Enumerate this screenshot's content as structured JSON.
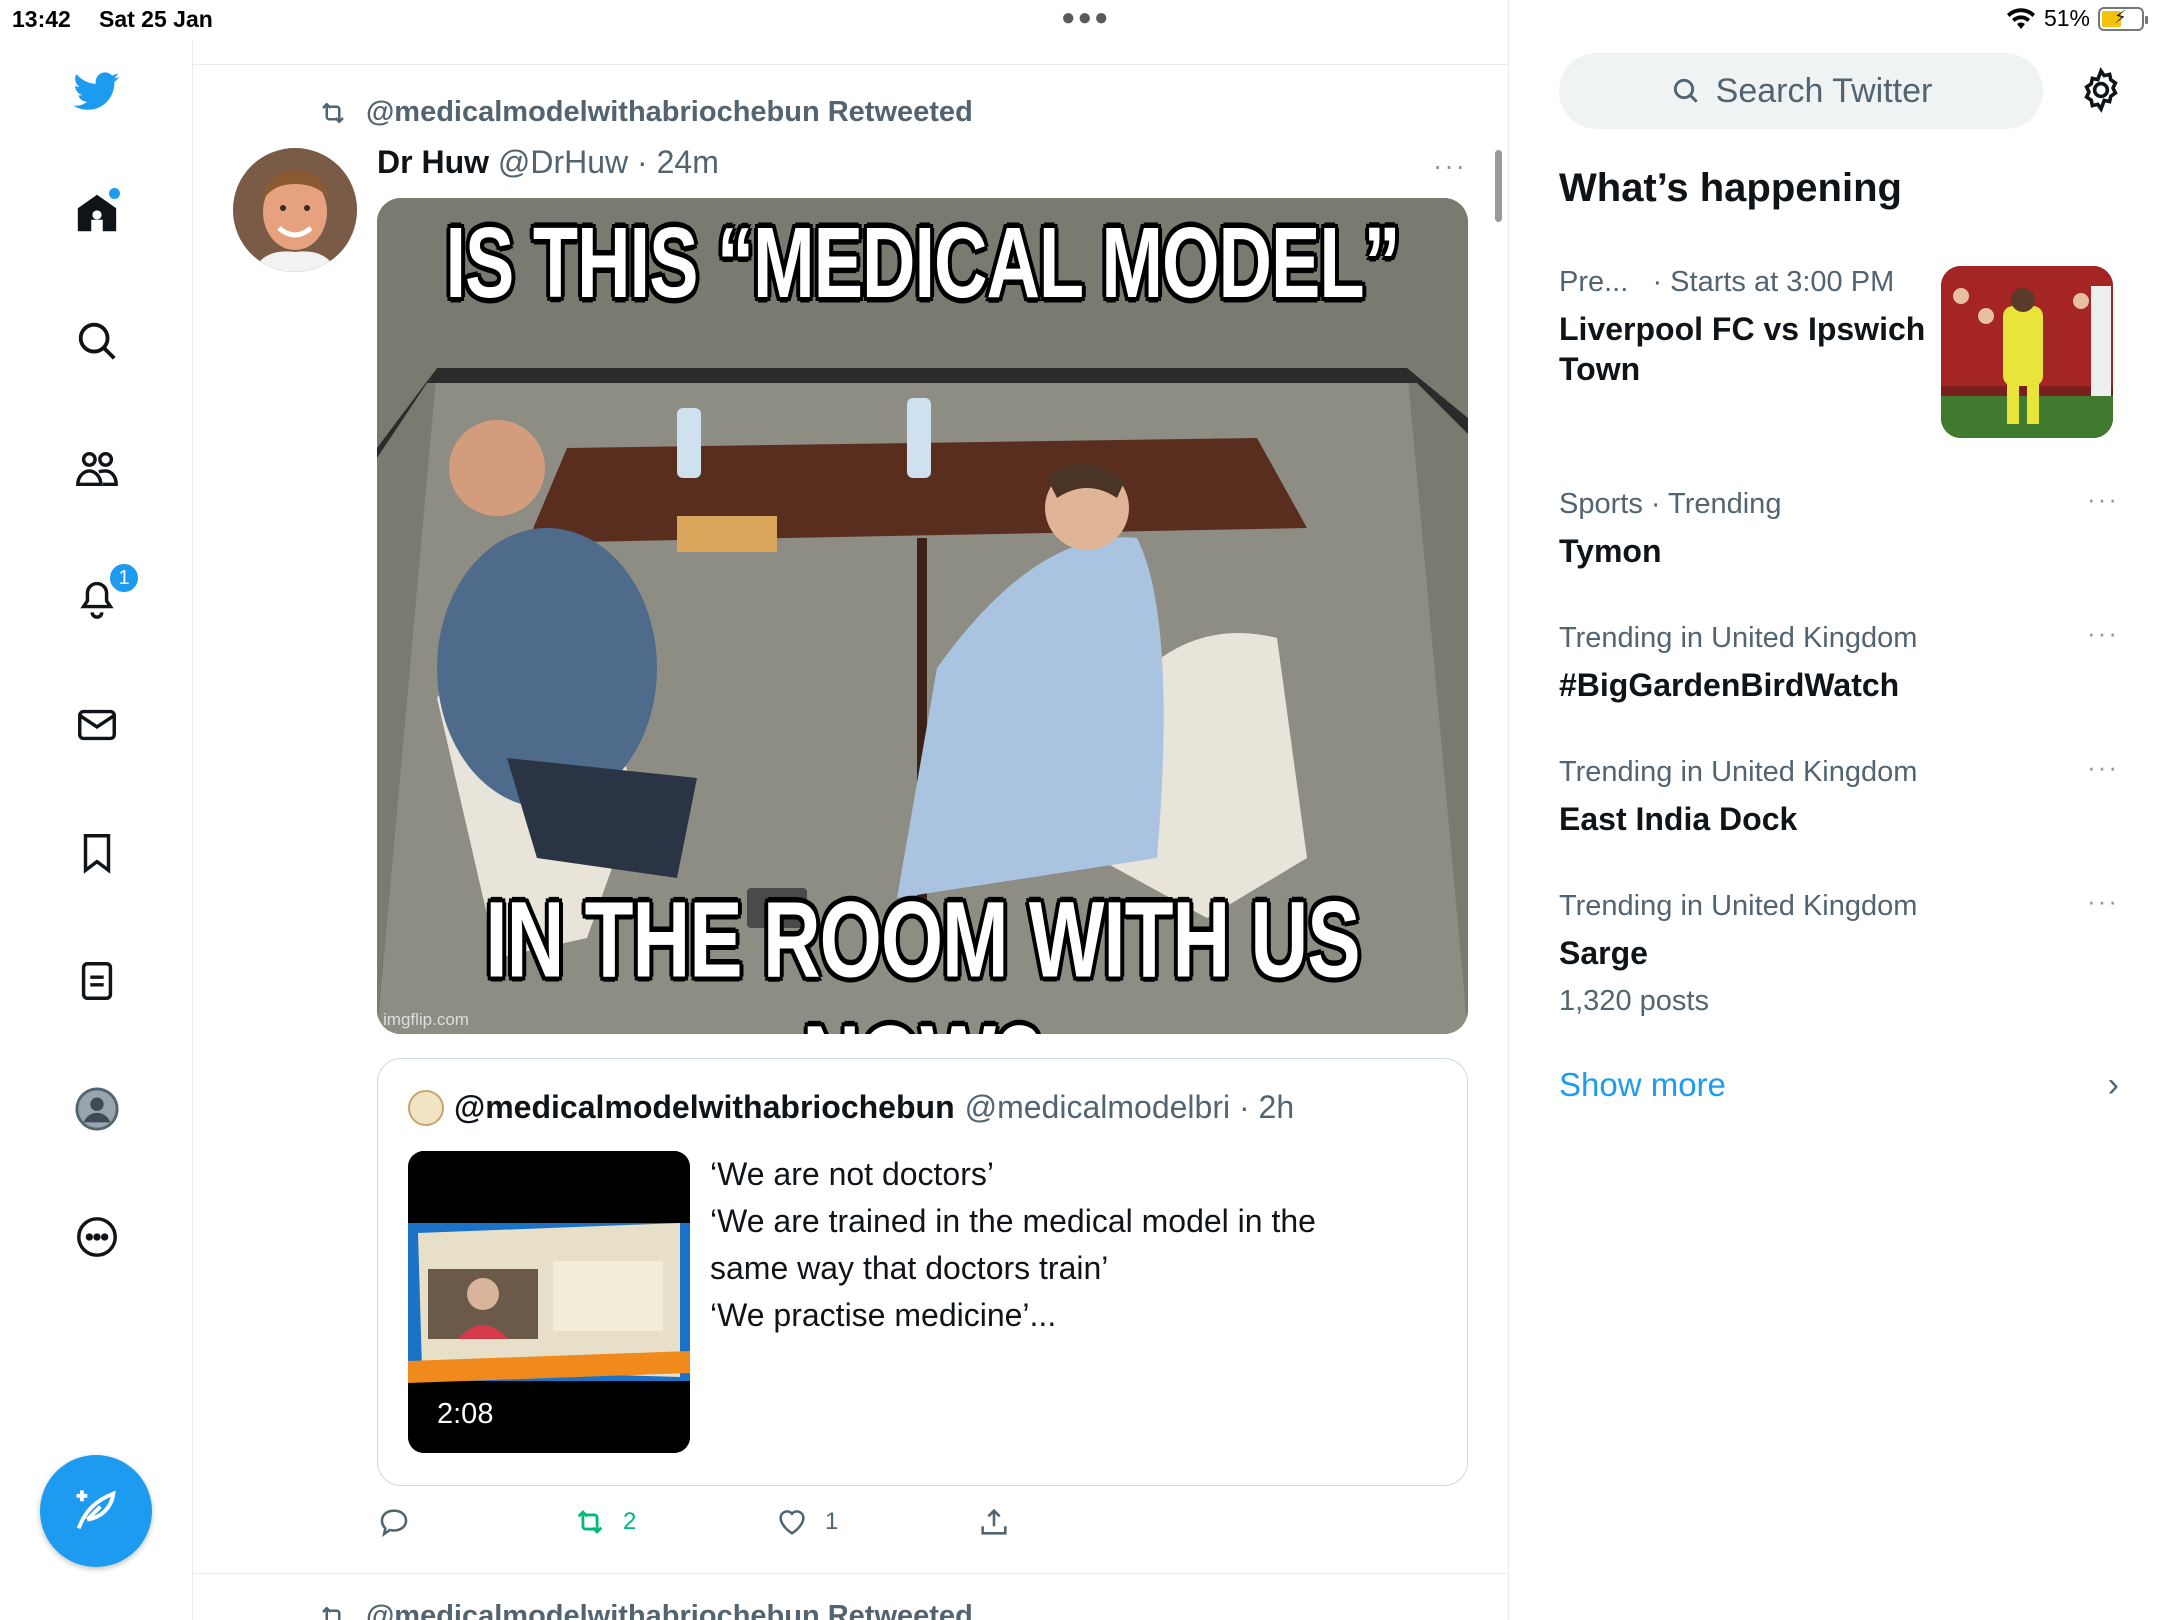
{
  "status_bar": {
    "time": "13:42",
    "date": "Sat 25 Jan",
    "battery": "51%"
  },
  "nav": {
    "notification_count": "1"
  },
  "tweet": {
    "retweeted_by": "@medicalmodelwithabriochebun Retweeted",
    "author_name": "Dr Huw",
    "author_handle": "@DrHuw",
    "time": "· 24m",
    "more": "···",
    "meme_top": "IS THIS “MEDICAL MODEL”",
    "meme_bottom": "IN THE ROOM WITH US NOW?",
    "meme_watermark": "imgflip.com",
    "quote": {
      "name": "@medicalmodelwithabriochebun",
      "handle": "@medicalmodelbri · 2h",
      "lines": [
        "‘We are not doctors’",
        "‘We are trained in the medical model in the",
        "same way that doctors train’",
        " ‘We practise medicine’..."
      ],
      "video_duration": "2:08"
    },
    "actions": {
      "reply": "",
      "retweets": "2",
      "likes": "1"
    }
  },
  "next_tweet": {
    "retweeted_by": "@medicalmodelwithabriochebun Retweeted"
  },
  "sidebar": {
    "search_placeholder": "Search Twitter",
    "heading": "What’s happening",
    "trends": [
      {
        "meta": "Pre...   · Starts at 3:00 PM",
        "title": "Liverpool FC vs Ipswich Town",
        "posts": ""
      },
      {
        "meta": "Sports · Trending",
        "title": "Tymon",
        "posts": ""
      },
      {
        "meta": "Trending in United Kingdom",
        "title": "#BigGardenBirdWatch",
        "posts": ""
      },
      {
        "meta": "Trending in United Kingdom",
        "title": "East India Dock",
        "posts": ""
      },
      {
        "meta": "Trending in United Kingdom",
        "title": "Sarge",
        "posts": "1,320 posts"
      }
    ],
    "show_more": "Show more"
  },
  "colors": {
    "accent": "#1d9bf0",
    "retweet_green": "#00ba7c",
    "secondary_text": "#536471"
  }
}
